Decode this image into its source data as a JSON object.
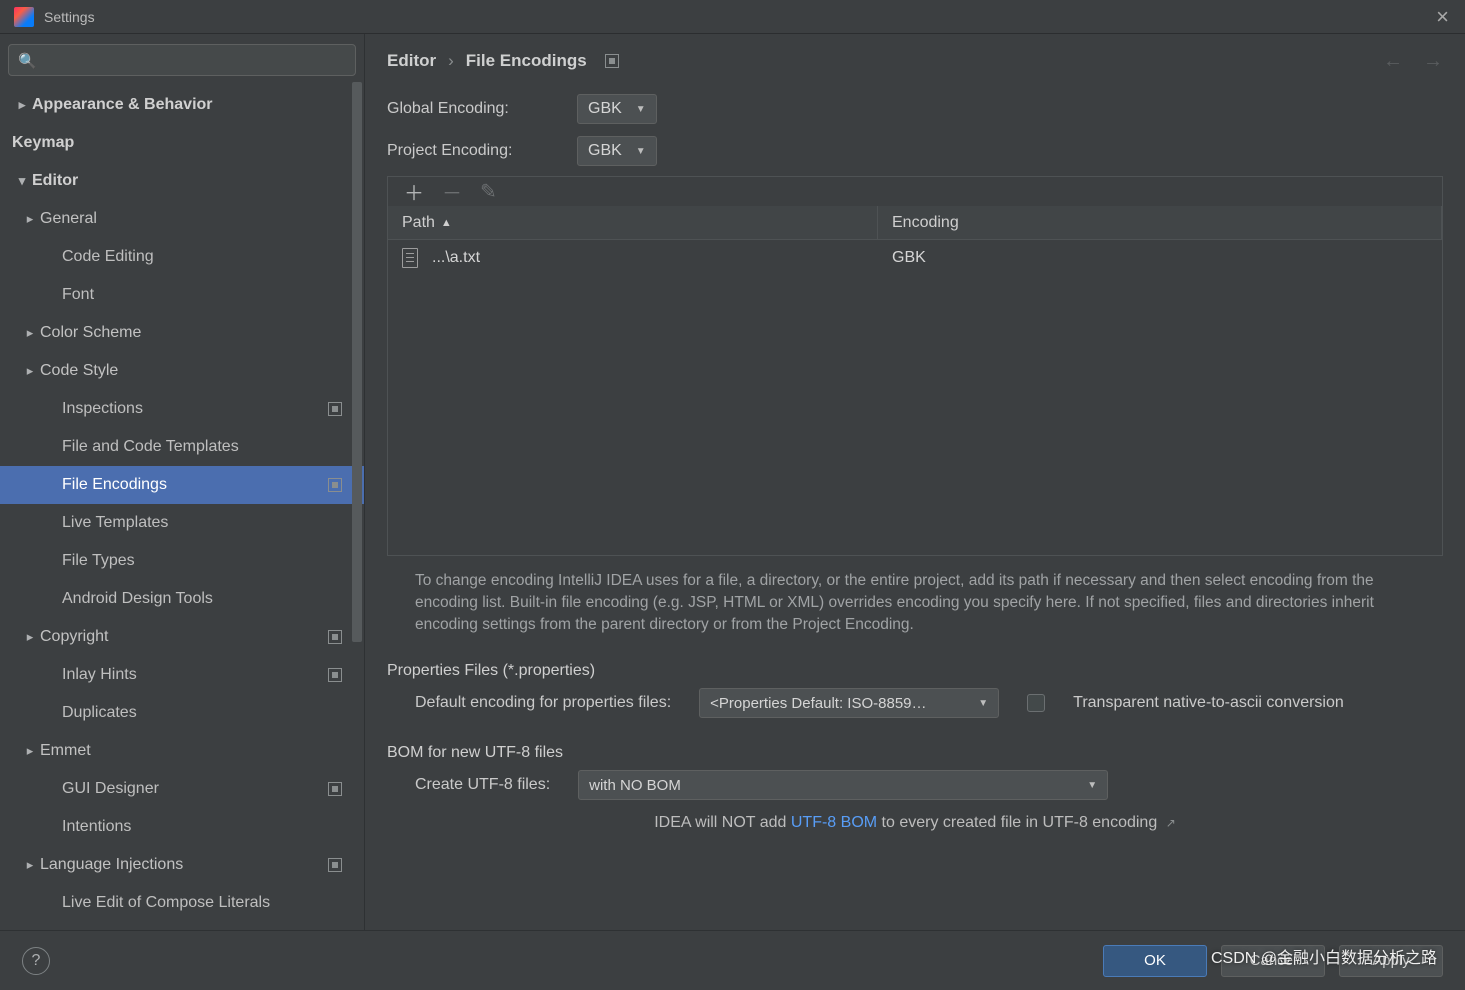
{
  "window_title": "Settings",
  "search_placeholder": "",
  "breadcrumb": {
    "root": "Editor",
    "current": "File Encodings"
  },
  "sidebar": [
    {
      "label": "Appearance & Behavior",
      "level": 0,
      "arrow": ">"
    },
    {
      "label": "Keymap",
      "level": 0
    },
    {
      "label": "Editor",
      "level": 0,
      "arrow": "v"
    },
    {
      "label": "General",
      "level": 1,
      "arrow": ">"
    },
    {
      "label": "Code Editing",
      "level": 2
    },
    {
      "label": "Font",
      "level": 2
    },
    {
      "label": "Color Scheme",
      "level": 1,
      "arrow": ">"
    },
    {
      "label": "Code Style",
      "level": 1,
      "arrow": ">"
    },
    {
      "label": "Inspections",
      "level": 2,
      "badge": true
    },
    {
      "label": "File and Code Templates",
      "level": 2
    },
    {
      "label": "File Encodings",
      "level": 2,
      "badge": true,
      "selected": true
    },
    {
      "label": "Live Templates",
      "level": 2
    },
    {
      "label": "File Types",
      "level": 2
    },
    {
      "label": "Android Design Tools",
      "level": 2
    },
    {
      "label": "Copyright",
      "level": 1,
      "arrow": ">",
      "badge": true
    },
    {
      "label": "Inlay Hints",
      "level": 2,
      "badge": true
    },
    {
      "label": "Duplicates",
      "level": 2
    },
    {
      "label": "Emmet",
      "level": 1,
      "arrow": ">"
    },
    {
      "label": "GUI Designer",
      "level": 2,
      "badge": true
    },
    {
      "label": "Intentions",
      "level": 2
    },
    {
      "label": "Language Injections",
      "level": 1,
      "arrow": ">",
      "badge": true
    },
    {
      "label": "Live Edit of Compose Literals",
      "level": 2
    }
  ],
  "form": {
    "global_encoding_label": "Global Encoding:",
    "global_encoding_value": "GBK",
    "project_encoding_label": "Project Encoding:",
    "project_encoding_value": "GBK"
  },
  "table": {
    "cols": [
      "Path",
      "Encoding"
    ],
    "rows": [
      {
        "path": "...\\a.txt",
        "encoding": "GBK"
      }
    ]
  },
  "help_text": "To change encoding IntelliJ IDEA uses for a file, a directory, or the entire project, add its path if necessary and then select encoding from the encoding list. Built-in file encoding (e.g. JSP, HTML or XML) overrides encoding you specify here. If not specified, files and directories inherit encoding settings from the parent directory or from the Project Encoding.",
  "props": {
    "section": "Properties Files (*.properties)",
    "default_label": "Default encoding for properties files:",
    "default_value": "<Properties Default: ISO-8859…",
    "checkbox_label": "Transparent native-to-ascii conversion"
  },
  "bom": {
    "section": "BOM for new UTF-8 files",
    "create_label": "Create UTF-8 files:",
    "create_value": "with NO BOM",
    "note_pre": "IDEA will NOT add ",
    "note_link": "UTF-8 BOM",
    "note_post": " to every created file in UTF-8 encoding"
  },
  "buttons": {
    "ok": "OK",
    "cancel": "Cancel",
    "apply": "Apply"
  },
  "watermark": "CSDN @金融小白数据分析之路"
}
